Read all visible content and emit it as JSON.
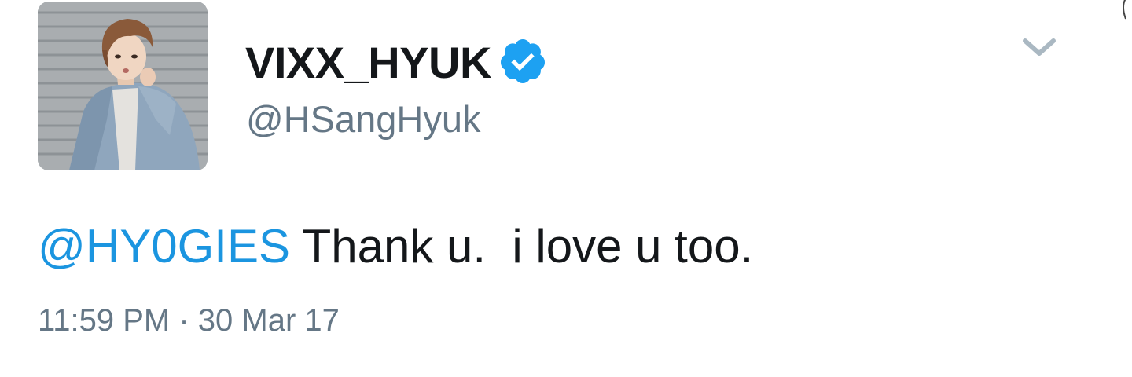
{
  "tweet": {
    "display_name": "VIXX_HYUK",
    "handle": "@HSangHyuk",
    "verified": true,
    "mention": "@HY0GIES",
    "text": " Thank u.  i love u too.",
    "timestamp": "11:59 PM · 30 Mar 17"
  },
  "icons": {
    "verified": "verified-badge-icon",
    "more": "chevron-down-icon"
  },
  "colors": {
    "accent": "#1b95e0",
    "verified": "#1da1f2",
    "primary_text": "#14171a",
    "secondary_text": "#657786",
    "chevron": "#aab8c2"
  }
}
